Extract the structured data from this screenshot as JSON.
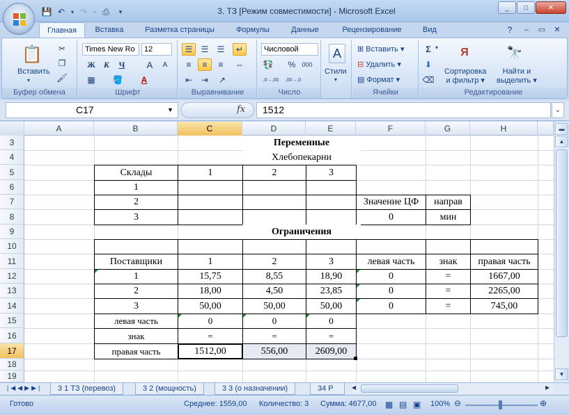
{
  "window": {
    "title": "3. ТЗ  [Режим совместимости] - Microsoft Excel",
    "minimize": "_",
    "maximize": "□",
    "close": "✕"
  },
  "ribbon_tabs": [
    "Главная",
    "Вставка",
    "Разметка страницы",
    "Формулы",
    "Данные",
    "Рецензирование",
    "Вид"
  ],
  "ribbon": {
    "clipboard": {
      "label": "Буфер обмена",
      "paste": "Вставить"
    },
    "font": {
      "label": "Шрифт",
      "name": "Times New Ro",
      "size": "12",
      "bold": "Ж",
      "italic": "К",
      "underline": "Ч",
      "grow": "A",
      "shrink": "A"
    },
    "alignment": {
      "label": "Выравнивание"
    },
    "number": {
      "label": "Число",
      "format": "Числовой",
      "percent": "%",
      "thousands": "000",
      "inc": ",0→,00",
      "dec": ",00→,0"
    },
    "styles": {
      "label": "Стили",
      "button": "Стили"
    },
    "cells": {
      "label": "Ячейки",
      "insert": "Вставить",
      "delete": "Удалить",
      "format": "Формат"
    },
    "editing": {
      "label": "Редактирование",
      "sigma": "Σ",
      "sort": "Сортировка\nи фильтр",
      "sort1": "Сортировка",
      "sort2": "и фильтр",
      "find1": "Найти и",
      "find2": "выделить"
    }
  },
  "formula_bar": {
    "name_box": "C17",
    "fx": "fx",
    "value": "1512"
  },
  "columns": [
    "A",
    "B",
    "C",
    "D",
    "E",
    "F",
    "G",
    "H"
  ],
  "rows": [
    "3",
    "4",
    "5",
    "6",
    "7",
    "8",
    "9",
    "10",
    "11",
    "12",
    "13",
    "14",
    "15",
    "16",
    "17",
    "18",
    "19"
  ],
  "cells": {
    "title1": "Переменные",
    "title2": "Хлебопекарни",
    "sklady": "Склады",
    "c1": "1",
    "c2": "2",
    "c3": "3",
    "r6": "1",
    "r7": "2",
    "r8": "3",
    "zn_cf": "Значение ЦФ",
    "naprav": "направ",
    "cf_val": "0",
    "min": "мин",
    "title3": "Ограничения",
    "postav": "Поставщики",
    "h1": "1",
    "h2": "2",
    "h3": "3",
    "lev": "левая часть",
    "znak": "знак",
    "prav": "правая часть",
    "table": [
      [
        "1",
        "15,75",
        "8,55",
        "18,90",
        "0",
        "=",
        "1667,00"
      ],
      [
        "2",
        "18,00",
        "4,50",
        "23,85",
        "0",
        "=",
        "2265,00"
      ],
      [
        "3",
        "50,00",
        "50,00",
        "50,00",
        "0",
        "=",
        "745,00"
      ]
    ],
    "lev_row": [
      "левая часть",
      "0",
      "0",
      "0"
    ],
    "znak_row": [
      "знак",
      "=",
      "=",
      "="
    ],
    "prav_row": [
      "правая часть",
      "1512,00",
      "556,00",
      "2609,00"
    ]
  },
  "sheet_tabs": [
    "3 1 ТЗ (перевоз)",
    "3 2 (мощность)",
    "3 3 (о назначении)",
    "34 Р"
  ],
  "status": {
    "ready": "Готово",
    "avg": "Среднее: 1559,00",
    "count": "Количество: 3",
    "sum": "Сумма: 4677,00",
    "zoom": "100%"
  }
}
